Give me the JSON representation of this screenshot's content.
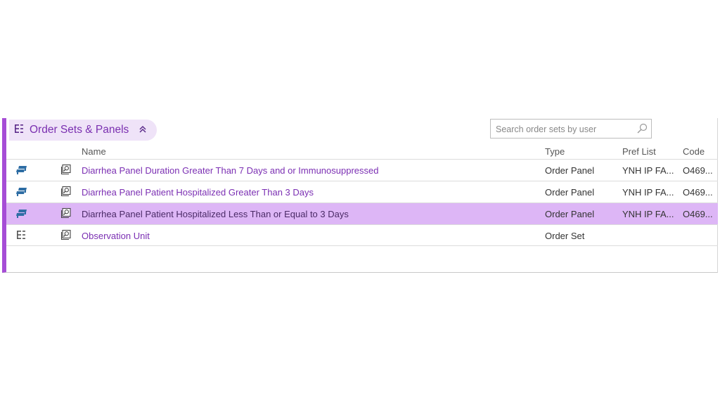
{
  "section": {
    "title": "Order Sets & Panels",
    "collapse_icon": "double-chevron-up-icon",
    "search_placeholder": "Search order sets by user"
  },
  "columns": {
    "name": "Name",
    "type": "Type",
    "pref_list": "Pref List",
    "code": "Code"
  },
  "rows": [
    {
      "icon": "order-panel-icon",
      "name": "Diarrhea Panel Duration Greater Than 7 Days and or Immunosuppressed",
      "type": "Order Panel",
      "pref_list": "YNH IP FA...",
      "code": "O469...",
      "selected": false
    },
    {
      "icon": "order-panel-icon",
      "name": "Diarrhea Panel Patient Hospitalized Greater Than 3 Days",
      "type": "Order Panel",
      "pref_list": "YNH IP FA...",
      "code": "O469...",
      "selected": false
    },
    {
      "icon": "order-panel-icon",
      "name": "Diarrhea Panel Patient Hospitalized Less Than or Equal to 3 Days",
      "type": "Order Panel",
      "pref_list": "YNH IP FA...",
      "code": "O469...",
      "selected": true
    },
    {
      "icon": "order-set-icon",
      "name": "Observation Unit",
      "type": "Order Set",
      "pref_list": "",
      "code": "",
      "selected": false
    }
  ],
  "colors": {
    "accent": "#a64dd6",
    "link": "#7b2fb3",
    "header_bg": "#efe3f8",
    "selected_row": "#ddb6f6",
    "panel_icon": "#2e6da4"
  }
}
